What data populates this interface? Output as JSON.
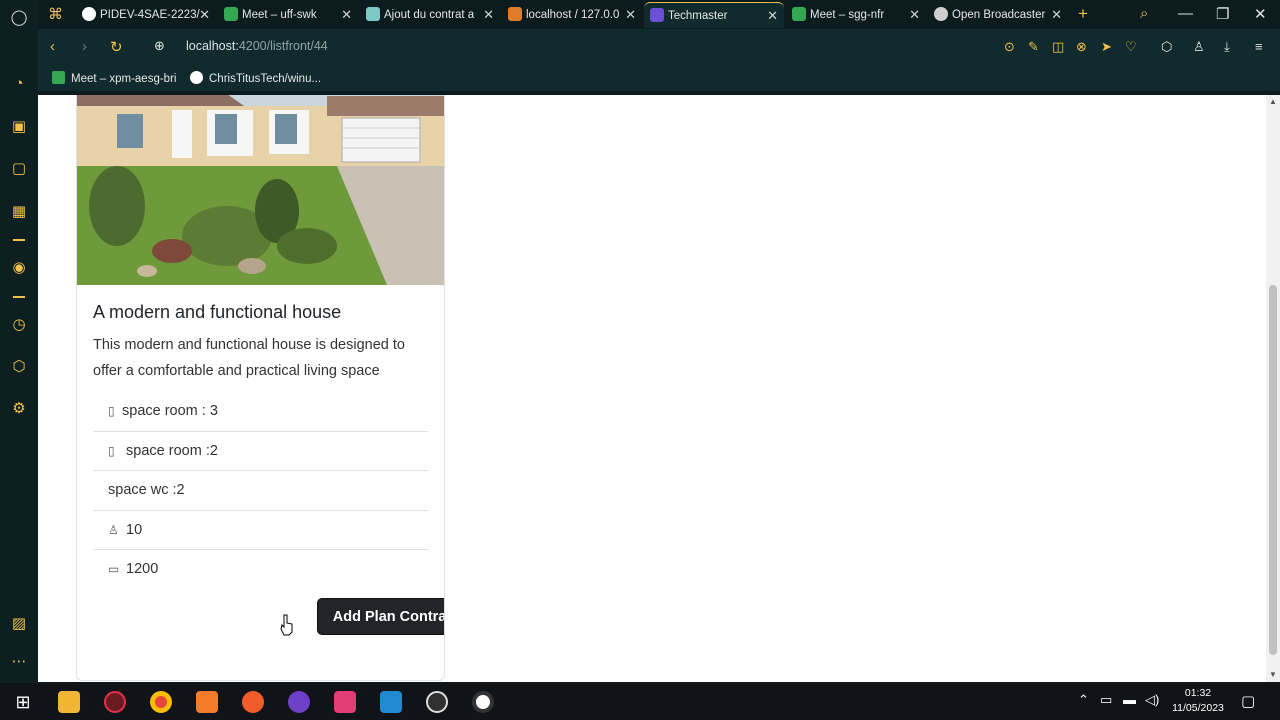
{
  "browser": {
    "tabs": [
      {
        "label": "PIDEV-4SAE-2223/",
        "color": "#ffffff"
      },
      {
        "label": "Meet – uff-swk",
        "color": "#34a853"
      },
      {
        "label": "Ajout du contrat a",
        "color": "#7fc8c8"
      },
      {
        "label": "localhost / 127.0.0",
        "color": "#e07b27"
      },
      {
        "label": "Techmaster",
        "color": "#6b4fd8"
      },
      {
        "label": "Meet – sgg-nfr",
        "color": "#34a853"
      },
      {
        "label": "Open Broadcaster",
        "color": "#cfcfcf"
      }
    ],
    "url_host": "localhost:",
    "url_path": "4200/listfront/44",
    "bookmarks": [
      {
        "label": "Meet – xpm-aesg-bri",
        "icon": "meet-icon"
      },
      {
        "label": "ChrisTitusTech/winu...",
        "icon": "github-icon"
      }
    ]
  },
  "card": {
    "title": "A modern and functional house",
    "description": "This modern and functional house is designed to offer a comfortable and practical living space",
    "details": [
      {
        "icon": "door-icon",
        "glyph": "▯",
        "text": "space room : 3"
      },
      {
        "icon": "door-open-icon",
        "glyph": "▯",
        "text": " space room :2"
      },
      {
        "icon": "",
        "glyph": "",
        "text": "space wc :2"
      },
      {
        "icon": "person-icon",
        "glyph": "♙",
        "text": " 10"
      },
      {
        "icon": "credit-card-icon",
        "glyph": "▭",
        "text": " 1200"
      }
    ],
    "button_label": "Add Plan Contrat"
  },
  "taskbar": {
    "time": "01:32",
    "date": "11/05/2023"
  }
}
